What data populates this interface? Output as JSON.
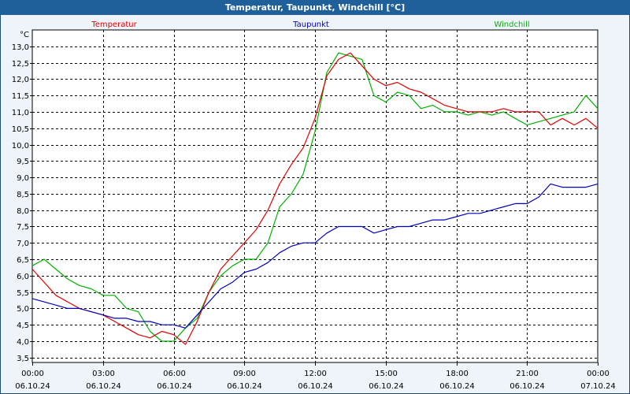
{
  "window": {
    "title": "Temperatur, Taupunkt, Windchill [°C]"
  },
  "colors": {
    "temperatur": "#e00000",
    "taupunkt": "#0000c0",
    "windchill": "#00b000",
    "titlebar": "#1f5f9a"
  },
  "chart_data": {
    "type": "line",
    "title": "Temperatur, Taupunkt, Windchill [°C]",
    "ylabel": "°C",
    "xlabel": "",
    "ylim": [
      3.35,
      13.5
    ],
    "grid": true,
    "legend_position": "top",
    "yticks": [
      3.5,
      4.0,
      4.5,
      5.0,
      5.5,
      6.0,
      6.5,
      7.0,
      7.5,
      8.0,
      8.5,
      9.0,
      9.5,
      10.0,
      10.5,
      11.0,
      11.5,
      12.0,
      12.5,
      13.0
    ],
    "ytick_labels": [
      "3,5",
      "4,0",
      "4,5",
      "5,0",
      "5,5",
      "6,0",
      "6,5",
      "7,0",
      "7,5",
      "8,0",
      "8,5",
      "9,0",
      "9,5",
      "10,0",
      "10,5",
      "11,0",
      "11,5",
      "12,0",
      "12,5",
      "13,0"
    ],
    "xticks": [
      {
        "time": "00:00",
        "date": "06.10.24"
      },
      {
        "time": "03:00",
        "date": "06.10.24"
      },
      {
        "time": "06:00",
        "date": "06.10.24"
      },
      {
        "time": "09:00",
        "date": "06.10.24"
      },
      {
        "time": "12:00",
        "date": "06.10.24"
      },
      {
        "time": "15:00",
        "date": "06.10.24"
      },
      {
        "time": "18:00",
        "date": "06.10.24"
      },
      {
        "time": "21:00",
        "date": "06.10.24"
      },
      {
        "time": "00:00",
        "date": "07.10.24"
      }
    ],
    "x": [
      "00:00",
      "00:30",
      "01:00",
      "01:30",
      "02:00",
      "02:30",
      "03:00",
      "03:30",
      "04:00",
      "04:30",
      "05:00",
      "05:30",
      "06:00",
      "06:30",
      "07:00",
      "07:30",
      "08:00",
      "08:30",
      "09:00",
      "09:30",
      "10:00",
      "10:30",
      "11:00",
      "11:30",
      "12:00",
      "12:30",
      "13:00",
      "13:30",
      "14:00",
      "14:30",
      "15:00",
      "15:30",
      "16:00",
      "16:30",
      "17:00",
      "17:30",
      "18:00",
      "18:30",
      "19:00",
      "19:30",
      "20:00",
      "20:30",
      "21:00",
      "21:30",
      "22:00",
      "22:30",
      "23:00",
      "23:30",
      "00:00"
    ],
    "series": [
      {
        "name": "Temperatur",
        "color": "#e00000",
        "values": [
          6.2,
          5.8,
          5.4,
          5.2,
          5.0,
          4.9,
          4.8,
          4.6,
          4.4,
          4.2,
          4.1,
          4.3,
          4.2,
          3.9,
          4.6,
          5.5,
          6.2,
          6.6,
          7.0,
          7.4,
          8.0,
          8.8,
          9.4,
          9.9,
          10.8,
          12.1,
          12.6,
          12.8,
          12.4,
          12.0,
          11.8,
          11.9,
          11.7,
          11.6,
          11.4,
          11.2,
          11.1,
          11.0,
          11.0,
          11.0,
          11.1,
          11.0,
          11.0,
          11.0,
          10.6,
          10.8,
          10.6,
          10.8,
          10.5
        ]
      },
      {
        "name": "Taupunkt",
        "color": "#0000c0",
        "values": [
          5.3,
          5.2,
          5.1,
          5.0,
          5.0,
          4.9,
          4.8,
          4.7,
          4.7,
          4.6,
          4.6,
          4.5,
          4.5,
          4.4,
          4.8,
          5.2,
          5.6,
          5.8,
          6.1,
          6.2,
          6.4,
          6.7,
          6.9,
          7.0,
          7.0,
          7.3,
          7.5,
          7.5,
          7.5,
          7.3,
          7.4,
          7.5,
          7.5,
          7.6,
          7.7,
          7.7,
          7.8,
          7.9,
          7.9,
          8.0,
          8.1,
          8.2,
          8.2,
          8.4,
          8.8,
          8.7,
          8.7,
          8.7,
          8.8
        ]
      },
      {
        "name": "Windchill",
        "color": "#00b000",
        "values": [
          6.3,
          6.5,
          6.2,
          5.9,
          5.7,
          5.6,
          5.4,
          5.4,
          5.0,
          4.9,
          4.3,
          4.0,
          4.0,
          4.4,
          4.7,
          5.5,
          6.0,
          6.3,
          6.5,
          6.5,
          7.0,
          8.1,
          8.5,
          9.1,
          10.4,
          12.2,
          12.8,
          12.7,
          12.6,
          11.5,
          11.3,
          11.6,
          11.5,
          11.1,
          11.2,
          11.0,
          11.0,
          10.9,
          11.0,
          10.9,
          11.0,
          10.8,
          10.6,
          10.7,
          10.8,
          10.9,
          11.0,
          11.5,
          11.1
        ]
      }
    ]
  }
}
